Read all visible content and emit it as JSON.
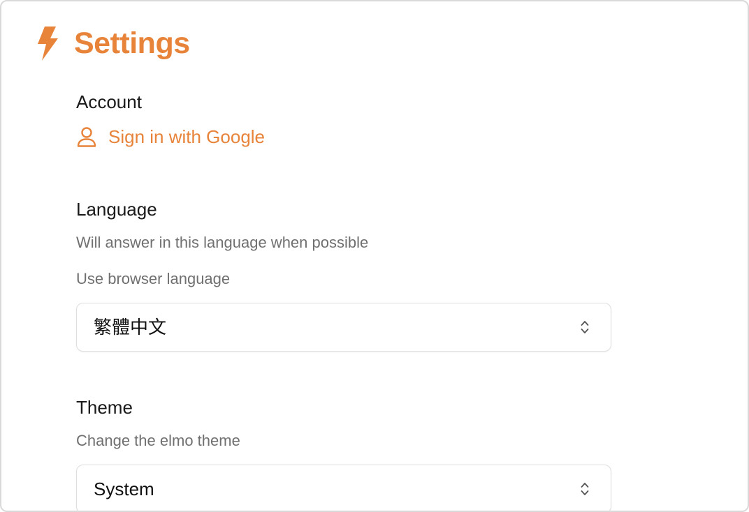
{
  "header": {
    "title": "Settings",
    "icon": "lightning-bolt-icon",
    "accent_color": "#e8833a"
  },
  "account": {
    "title": "Account",
    "signin_label": "Sign in with Google",
    "signin_icon": "user-icon"
  },
  "language": {
    "title": "Language",
    "description": "Will answer in this language when possible",
    "browser_option": "Use browser language",
    "selected": "繁體中文"
  },
  "theme": {
    "title": "Theme",
    "description": "Change the elmo theme",
    "selected": "System"
  }
}
